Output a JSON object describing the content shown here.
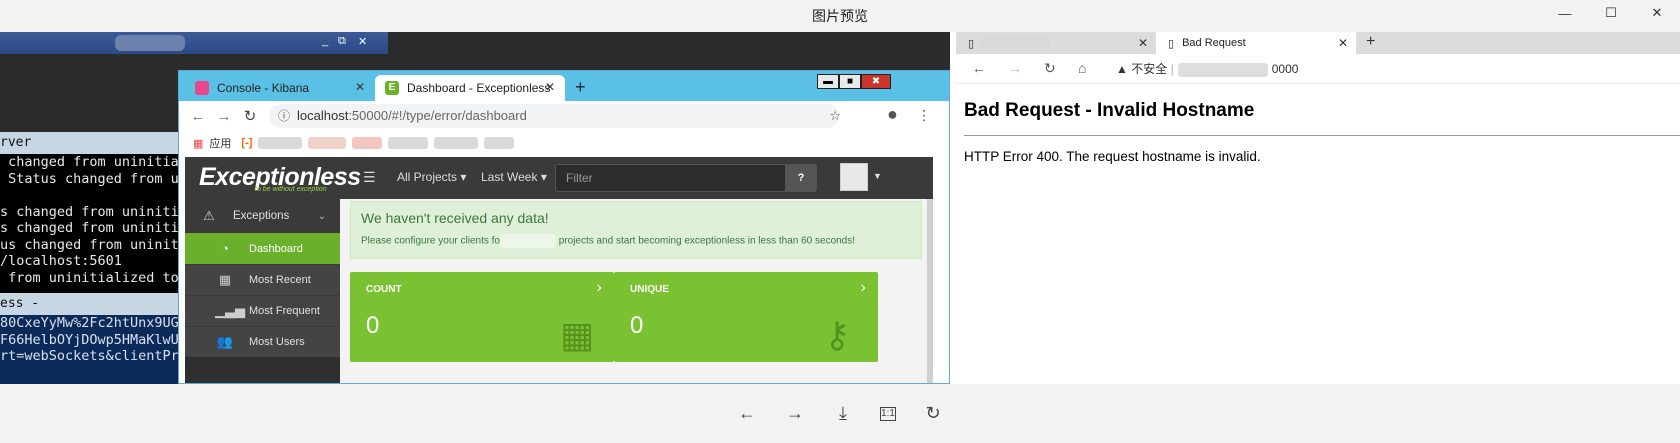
{
  "viewer": {
    "title": "图片预览",
    "controls": {
      "minimize": "—",
      "maximize": "☐",
      "close": "✕"
    },
    "toolbar": {
      "prev": "←",
      "next": "→",
      "download": "⤓",
      "actual_size": "1:1",
      "rotate": "↻"
    }
  },
  "terminal": {
    "title_controls": {
      "minimize": "_",
      "restore": "⧉",
      "close": "✕"
    },
    "section1_header": "rver",
    "section1_lines": [
      " changed from uninitia",
      " Status changed from u",
      "",
      "s changed from uniniti",
      "s changed from uniniti",
      "us changed from uninit",
      "/localhost:5601",
      " from uninitialized to"
    ],
    "section2_header": "ess -",
    "section2_lines": [
      "80CxeYyMw%2Fc2htUnx9UG",
      "F66HelbOYjDOwp5HMaKlwU",
      "rt=webSockets&clientPr"
    ]
  },
  "chrome": {
    "tabs": [
      {
        "label": "Console - Kibana",
        "icon": "kibana-icon"
      },
      {
        "label": "Dashboard - Exceptionless",
        "icon": "exceptionless-icon"
      }
    ],
    "new_tab": "+",
    "window_buttons": {
      "minimize": "▬",
      "maximize": "■",
      "close": "✖"
    },
    "url": "localhost:50000/#!/type/error/dashboard",
    "url_host": "localhost",
    "url_rest": ":50000/#!/type/error/dashboard",
    "bookmarks_apps": "应用"
  },
  "app": {
    "logo": "Exceptionless",
    "logo_tagline": "to be without exception",
    "menu_projects": "All Projects",
    "menu_period": "Last Week",
    "filter_placeholder": "Filter",
    "help_label": "?",
    "sidebar": {
      "group": "Exceptions",
      "items": [
        {
          "label": "Dashboard",
          "icon": "dashboard-icon",
          "active": true
        },
        {
          "label": "Most Recent",
          "icon": "calendar-icon",
          "active": false
        },
        {
          "label": "Most Frequent",
          "icon": "signal-icon",
          "active": false
        },
        {
          "label": "Most Users",
          "icon": "users-icon",
          "active": false
        }
      ]
    },
    "notice": {
      "heading": "We haven't received any data!",
      "text_before": "Please configure your clients fo",
      "text_after": " projects and start becoming exceptionless in less than 60 seconds!"
    },
    "tiles": [
      {
        "label": "COUNT",
        "value": "0",
        "icon": "calendar-icon"
      },
      {
        "label": "UNIQUE",
        "value": "0",
        "icon": "key-icon"
      }
    ]
  },
  "right_browser": {
    "tabs": [
      {
        "label": "",
        "icon": "page-icon"
      },
      {
        "label": "Bad Request",
        "icon": "page-icon"
      }
    ],
    "new_tab": "+",
    "insecure_label": "不安全",
    "address_suffix": "0000",
    "heading": "Bad Request - Invalid Hostname",
    "message": "HTTP Error 400. The request hostname is invalid."
  }
}
